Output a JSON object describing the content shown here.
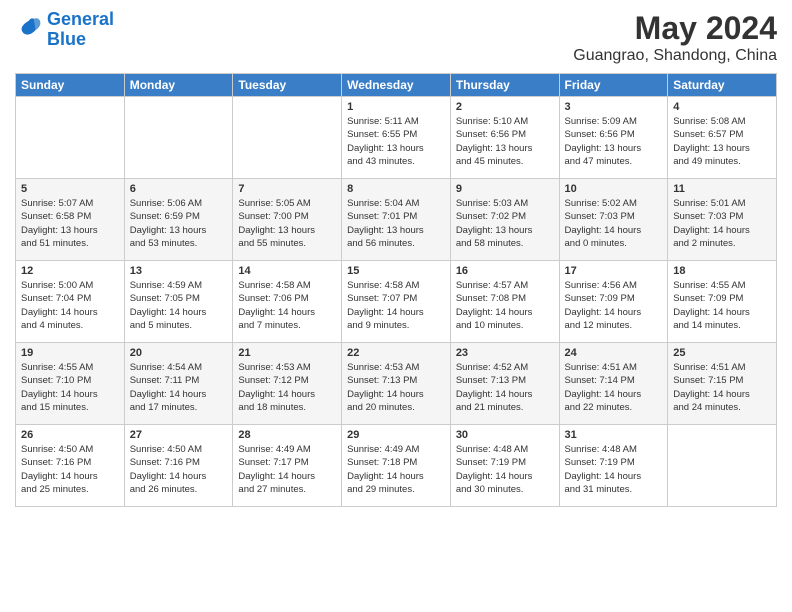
{
  "logo": {
    "line1": "General",
    "line2": "Blue"
  },
  "title": "May 2024",
  "location": "Guangrao, Shandong, China",
  "days_of_week": [
    "Sunday",
    "Monday",
    "Tuesday",
    "Wednesday",
    "Thursday",
    "Friday",
    "Saturday"
  ],
  "weeks": [
    [
      {
        "day": "",
        "info": ""
      },
      {
        "day": "",
        "info": ""
      },
      {
        "day": "",
        "info": ""
      },
      {
        "day": "1",
        "info": "Sunrise: 5:11 AM\nSunset: 6:55 PM\nDaylight: 13 hours\nand 43 minutes."
      },
      {
        "day": "2",
        "info": "Sunrise: 5:10 AM\nSunset: 6:56 PM\nDaylight: 13 hours\nand 45 minutes."
      },
      {
        "day": "3",
        "info": "Sunrise: 5:09 AM\nSunset: 6:56 PM\nDaylight: 13 hours\nand 47 minutes."
      },
      {
        "day": "4",
        "info": "Sunrise: 5:08 AM\nSunset: 6:57 PM\nDaylight: 13 hours\nand 49 minutes."
      }
    ],
    [
      {
        "day": "5",
        "info": "Sunrise: 5:07 AM\nSunset: 6:58 PM\nDaylight: 13 hours\nand 51 minutes."
      },
      {
        "day": "6",
        "info": "Sunrise: 5:06 AM\nSunset: 6:59 PM\nDaylight: 13 hours\nand 53 minutes."
      },
      {
        "day": "7",
        "info": "Sunrise: 5:05 AM\nSunset: 7:00 PM\nDaylight: 13 hours\nand 55 minutes."
      },
      {
        "day": "8",
        "info": "Sunrise: 5:04 AM\nSunset: 7:01 PM\nDaylight: 13 hours\nand 56 minutes."
      },
      {
        "day": "9",
        "info": "Sunrise: 5:03 AM\nSunset: 7:02 PM\nDaylight: 13 hours\nand 58 minutes."
      },
      {
        "day": "10",
        "info": "Sunrise: 5:02 AM\nSunset: 7:03 PM\nDaylight: 14 hours\nand 0 minutes."
      },
      {
        "day": "11",
        "info": "Sunrise: 5:01 AM\nSunset: 7:03 PM\nDaylight: 14 hours\nand 2 minutes."
      }
    ],
    [
      {
        "day": "12",
        "info": "Sunrise: 5:00 AM\nSunset: 7:04 PM\nDaylight: 14 hours\nand 4 minutes."
      },
      {
        "day": "13",
        "info": "Sunrise: 4:59 AM\nSunset: 7:05 PM\nDaylight: 14 hours\nand 5 minutes."
      },
      {
        "day": "14",
        "info": "Sunrise: 4:58 AM\nSunset: 7:06 PM\nDaylight: 14 hours\nand 7 minutes."
      },
      {
        "day": "15",
        "info": "Sunrise: 4:58 AM\nSunset: 7:07 PM\nDaylight: 14 hours\nand 9 minutes."
      },
      {
        "day": "16",
        "info": "Sunrise: 4:57 AM\nSunset: 7:08 PM\nDaylight: 14 hours\nand 10 minutes."
      },
      {
        "day": "17",
        "info": "Sunrise: 4:56 AM\nSunset: 7:09 PM\nDaylight: 14 hours\nand 12 minutes."
      },
      {
        "day": "18",
        "info": "Sunrise: 4:55 AM\nSunset: 7:09 PM\nDaylight: 14 hours\nand 14 minutes."
      }
    ],
    [
      {
        "day": "19",
        "info": "Sunrise: 4:55 AM\nSunset: 7:10 PM\nDaylight: 14 hours\nand 15 minutes."
      },
      {
        "day": "20",
        "info": "Sunrise: 4:54 AM\nSunset: 7:11 PM\nDaylight: 14 hours\nand 17 minutes."
      },
      {
        "day": "21",
        "info": "Sunrise: 4:53 AM\nSunset: 7:12 PM\nDaylight: 14 hours\nand 18 minutes."
      },
      {
        "day": "22",
        "info": "Sunrise: 4:53 AM\nSunset: 7:13 PM\nDaylight: 14 hours\nand 20 minutes."
      },
      {
        "day": "23",
        "info": "Sunrise: 4:52 AM\nSunset: 7:13 PM\nDaylight: 14 hours\nand 21 minutes."
      },
      {
        "day": "24",
        "info": "Sunrise: 4:51 AM\nSunset: 7:14 PM\nDaylight: 14 hours\nand 22 minutes."
      },
      {
        "day": "25",
        "info": "Sunrise: 4:51 AM\nSunset: 7:15 PM\nDaylight: 14 hours\nand 24 minutes."
      }
    ],
    [
      {
        "day": "26",
        "info": "Sunrise: 4:50 AM\nSunset: 7:16 PM\nDaylight: 14 hours\nand 25 minutes."
      },
      {
        "day": "27",
        "info": "Sunrise: 4:50 AM\nSunset: 7:16 PM\nDaylight: 14 hours\nand 26 minutes."
      },
      {
        "day": "28",
        "info": "Sunrise: 4:49 AM\nSunset: 7:17 PM\nDaylight: 14 hours\nand 27 minutes."
      },
      {
        "day": "29",
        "info": "Sunrise: 4:49 AM\nSunset: 7:18 PM\nDaylight: 14 hours\nand 29 minutes."
      },
      {
        "day": "30",
        "info": "Sunrise: 4:48 AM\nSunset: 7:19 PM\nDaylight: 14 hours\nand 30 minutes."
      },
      {
        "day": "31",
        "info": "Sunrise: 4:48 AM\nSunset: 7:19 PM\nDaylight: 14 hours\nand 31 minutes."
      },
      {
        "day": "",
        "info": ""
      }
    ]
  ]
}
